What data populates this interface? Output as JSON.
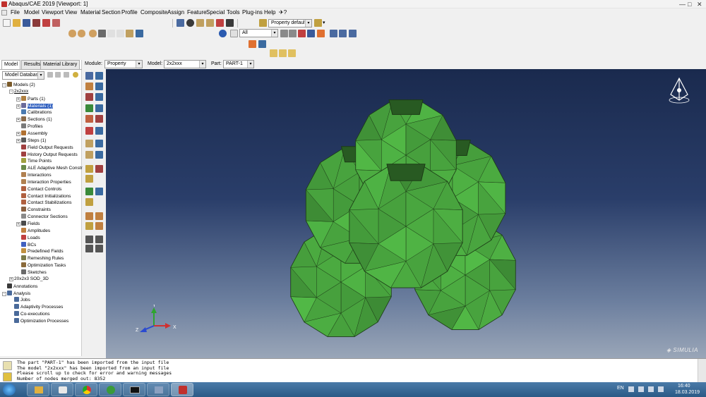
{
  "window": {
    "title": "Abaqus/CAE 2019 [Viewport: 1]"
  },
  "menu": [
    "File",
    "Model",
    "Viewport",
    "View",
    "Material",
    "Section",
    "Profile",
    "Composite",
    "Assign",
    "Feature",
    "Special",
    "Tools",
    "Plug-ins",
    "Help",
    "✈?"
  ],
  "toolbar": {
    "render_style": "Property defaults",
    "selection_filter": "All"
  },
  "context": {
    "module_label": "Module:",
    "module_value": "Property",
    "model_label": "Model:",
    "model_value": "2x2xxx",
    "part_label": "Part:",
    "part_value": "PART-1"
  },
  "tabs": [
    "Model",
    "Results",
    "Material Library"
  ],
  "tree_selector": "Model Database",
  "tree": [
    {
      "text": "Models (2)",
      "level": 0,
      "exp": "-",
      "color": "#7a5a2a"
    },
    {
      "text": "2x2xxx",
      "level": 1,
      "exp": "-",
      "color": "",
      "underline": true
    },
    {
      "text": "Parts (1)",
      "level": 2,
      "exp": "+",
      "color": "#b08040"
    },
    {
      "text": "Materials (1)",
      "level": 2,
      "exp": "+",
      "color": "#6a6a9a",
      "sel": true
    },
    {
      "text": "Calibrations",
      "level": 2,
      "exp": "",
      "color": "#4a7ab0"
    },
    {
      "text": "Sections (1)",
      "level": 2,
      "exp": "+",
      "color": "#8a6a4a"
    },
    {
      "text": "Profiles",
      "level": 2,
      "exp": "",
      "color": "#7a7a7a"
    },
    {
      "text": "Assembly",
      "level": 2,
      "exp": "+",
      "color": "#b07030"
    },
    {
      "text": "Steps (1)",
      "level": 2,
      "exp": "+",
      "color": "#5a5a5a"
    },
    {
      "text": "Field Output Requests",
      "level": 2,
      "exp": "",
      "color": "#a04040"
    },
    {
      "text": "History Output Requests",
      "level": 2,
      "exp": "",
      "color": "#a04040"
    },
    {
      "text": "Time Points",
      "level": 2,
      "exp": "",
      "color": "#a0a040"
    },
    {
      "text": "ALE Adaptive Mesh Constraints",
      "level": 2,
      "exp": "",
      "color": "#6a8a4a"
    },
    {
      "text": "Interactions",
      "level": 2,
      "exp": "",
      "color": "#b08050"
    },
    {
      "text": "Interaction Properties",
      "level": 2,
      "exp": "",
      "color": "#b08050"
    },
    {
      "text": "Contact Controls",
      "level": 2,
      "exp": "",
      "color": "#b06040"
    },
    {
      "text": "Contact Initializations",
      "level": 2,
      "exp": "",
      "color": "#b06040"
    },
    {
      "text": "Contact Stabilizations",
      "level": 2,
      "exp": "",
      "color": "#b06040"
    },
    {
      "text": "Constraints",
      "level": 2,
      "exp": "",
      "color": "#8a6040"
    },
    {
      "text": "Connector Sections",
      "level": 2,
      "exp": "",
      "color": "#8a8a8a"
    },
    {
      "text": "Fields",
      "level": 2,
      "exp": "+",
      "color": "#4a4a4a"
    },
    {
      "text": "Amplitudes",
      "level": 2,
      "exp": "",
      "color": "#c08040"
    },
    {
      "text": "Loads",
      "level": 2,
      "exp": "",
      "color": "#c04040"
    },
    {
      "text": "BCs",
      "level": 2,
      "exp": "",
      "color": "#4060c0"
    },
    {
      "text": "Predefined Fields",
      "level": 2,
      "exp": "",
      "color": "#c09040"
    },
    {
      "text": "Remeshing Rules",
      "level": 2,
      "exp": "",
      "color": "#7a7a4a"
    },
    {
      "text": "Optimization Tasks",
      "level": 2,
      "exp": "",
      "color": "#8a6a3a"
    },
    {
      "text": "Sketches",
      "level": 2,
      "exp": "",
      "color": "#6a6a6a"
    },
    {
      "text": "20x2x3 SOD_3D",
      "level": 1,
      "exp": "+",
      "color": ""
    },
    {
      "text": "Annotations",
      "level": 0,
      "exp": "",
      "color": "#3a3a3a"
    },
    {
      "text": "Analysis",
      "level": 0,
      "exp": "-",
      "color": "#4a6a9a"
    },
    {
      "text": "Jobs",
      "level": 1,
      "exp": "",
      "color": "#4a6a9a"
    },
    {
      "text": "Adaptivity Processes",
      "level": 1,
      "exp": "",
      "color": "#4a6a9a"
    },
    {
      "text": "Co-executions",
      "level": 1,
      "exp": "",
      "color": "#4a6a9a"
    },
    {
      "text": "Optimization Processes",
      "level": 1,
      "exp": "",
      "color": "#4a6a9a"
    }
  ],
  "triad": {
    "x": "X",
    "y": "Y",
    "z": "Z"
  },
  "brand": "SIMULIA",
  "messages": [
    "The part \"PART-1\" has been imported from the input file",
    "The model \"2x2xxx\" has been imported from an input file",
    "Please scroll up to check for error and warning messages",
    "Number of nodes merged out: 8352"
  ],
  "taskbar": {
    "lang": "EN",
    "time": "16:40",
    "date": "18.03.2019"
  },
  "colors": {
    "mesh_fill": "#48a33e",
    "mesh_edge": "#1c3a16",
    "viewport_top": "#1a2a4e",
    "viewport_bottom": "#9aa6b8"
  }
}
